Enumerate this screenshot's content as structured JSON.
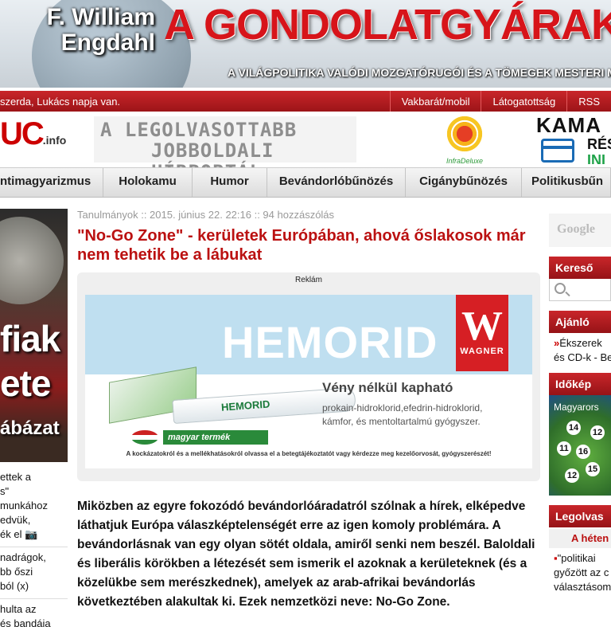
{
  "banner": {
    "author_line1": "F. William",
    "author_line2": "Engdahl",
    "title": "A GONDOLATGYÁRAK",
    "subtitle": "A VILÁGPOLITIKA VALÓDI MOZGATÓRUGÓI ÉS A TÖMEGEK MESTERI MANIP"
  },
  "infobar": {
    "date_text": "szerda, Lukács napja van.",
    "links": [
      "Vakbarát/mobil",
      "Látogatottság",
      "RSS"
    ]
  },
  "logo": {
    "text": "UC",
    "suffix": ".info"
  },
  "slogan": {
    "line1": "A LEGOLVASOTTABB",
    "line2": "JOBBOLDALI HÍRPORTÁL"
  },
  "ads": {
    "infradeluxe": "InfraDeluxe",
    "kama_line1": "KAMA",
    "kama_line2": "RÉS",
    "kama_line3": "INI"
  },
  "nav": {
    "items": [
      "ntimagyarizmus",
      "Holokamu",
      "Humor",
      "Bevándorlóbűnözés",
      "Cigánybűnözés",
      "Politikusbűn"
    ]
  },
  "left_sidebar": {
    "banner_line1": "fiak",
    "banner_line2": "ete",
    "banner_line3": "ábázat",
    "groups": [
      [
        "ettek a",
        "s\"",
        "munkához",
        "edvük,",
        "ék el 📷"
      ],
      [
        "nadrágok,",
        "bb őszi",
        "ból (x)"
      ],
      [
        "hulta az",
        "és bandája"
      ]
    ]
  },
  "article": {
    "meta": "Tanulmányok :: 2015. június 22. 22:16 :: 94 hozzászólás",
    "title": "\"No-Go Zone\" - kerületek Európában, ahová őslakosok már nem tehetik be a lábukat",
    "ad_label": "Reklám",
    "body": "Miközben az egyre fokozódó bevándorlóáradatról szólnak a hírek, elképedve láthatjuk Európa válaszképtelenségét erre az igen komoly problémára. A bevándorlásnak van egy olyan sötét oldala, amiről senki nem beszél. Baloldali és liberális körökben a létezését sem ismerik el azoknak a kerületeknek (és a közelükbe sem merészkednek), amelyek az arab-afrikai bevándorlás következtében alakultak ki. Ezek nemzetközi neve: No-Go Zone."
  },
  "ad": {
    "brand": "HEMORID",
    "logo_letter": "W",
    "logo_label": "WAGNER",
    "tube_label": "HEMORID",
    "claim": "Vény nélkül kapható",
    "ingredients_line1": "prokain-hidroklorid,efedrin-hidroklorid,",
    "ingredients_line2": "kámfor, és mentoltartalmú gyógyszer.",
    "made_in": "magyar termék",
    "disclaimer": "A kockázatokról és a mellékhatásokról olvassa el a betegtájékoztatót vagy kérdezze meg kezelőorvosát, gyógyszerészét!"
  },
  "right_sidebar": {
    "google_placeholder": "Google",
    "search_title": "Kereső",
    "recommend_title": "Ajánló",
    "recommend_line1": "Ékszerek",
    "recommend_line2": "és CD-k - Be",
    "weather_title": "Időkép",
    "weather_map_label": "Magyarors",
    "weather_temps": [
      "14",
      "12",
      "11",
      "16",
      "15",
      "12"
    ],
    "most_read_title": "Legolvas",
    "most_read_sub": "A héten",
    "most_read_line1": "\"politikai",
    "most_read_line2": "győzött az c",
    "most_read_line3": "választásom"
  },
  "colors": {
    "brand_red": "#c9262a",
    "headline_red": "#b11",
    "nav_bg": "#e6e6e6"
  }
}
